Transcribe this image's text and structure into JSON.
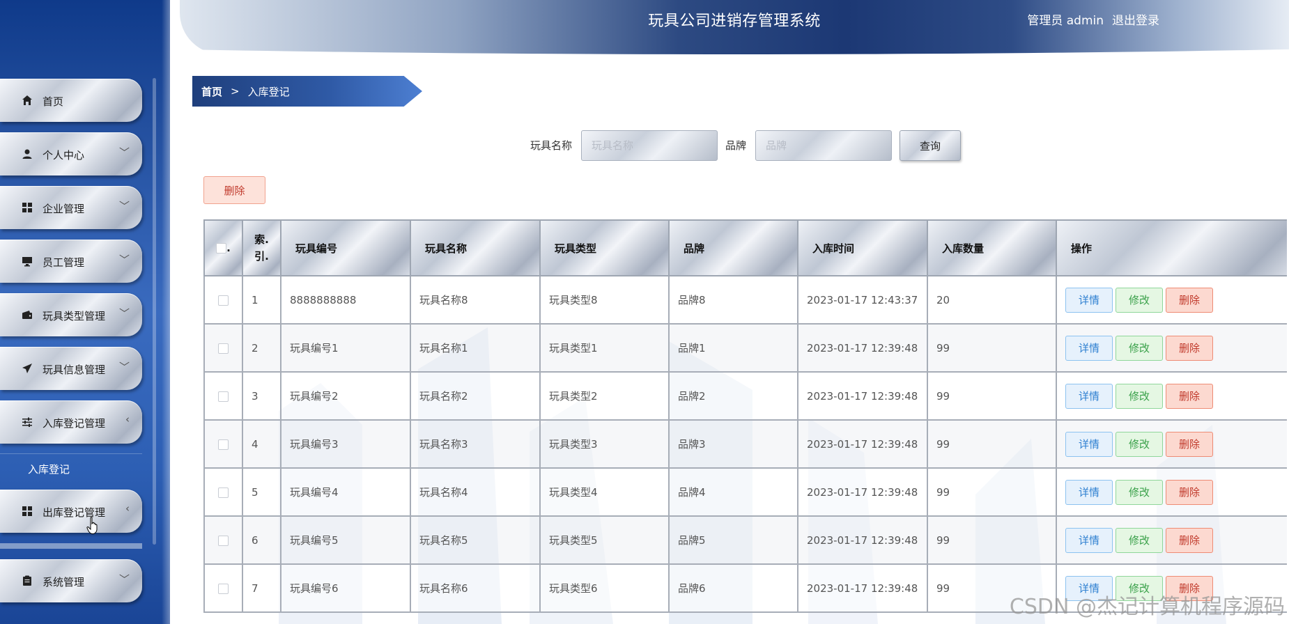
{
  "header": {
    "title": "玩具公司进销存管理系统",
    "user_label": "管理员 admin",
    "logout_label": "退出登录"
  },
  "sidebar": {
    "items": [
      {
        "label": "首页",
        "icon": "home-icon",
        "chevron": ""
      },
      {
        "label": "个人中心",
        "icon": "user-icon",
        "chevron": "﹀"
      },
      {
        "label": "企业管理",
        "icon": "grid-icon",
        "chevron": "﹀"
      },
      {
        "label": "员工管理",
        "icon": "monitor-icon",
        "chevron": "﹀"
      },
      {
        "label": "玩具类型管理",
        "icon": "wallet-icon",
        "chevron": "﹀"
      },
      {
        "label": "玩具信息管理",
        "icon": "send-icon",
        "chevron": "﹀"
      },
      {
        "label": "入库登记管理",
        "icon": "sliders-icon",
        "chevron": "‹"
      },
      {
        "label": "出库登记管理",
        "icon": "grid-icon",
        "chevron": "‹"
      },
      {
        "label": "系统管理",
        "icon": "clipboard-icon",
        "chevron": "﹀"
      }
    ],
    "sub_item": "入库登记"
  },
  "breadcrumb": {
    "home": "首页",
    "separator": ">",
    "current": "入库登记"
  },
  "search": {
    "name_label": "玩具名称",
    "name_placeholder": "玩具名称",
    "brand_label": "品牌",
    "brand_placeholder": "品牌",
    "query_label": "查询"
  },
  "toolbar": {
    "delete_label": "删除"
  },
  "table": {
    "columns": {
      "checkbox": ".",
      "index": "索引",
      "index_line1": "索.",
      "index_line2": "引.",
      "code": "玩具编号",
      "name": "玩具名称",
      "type": "玩具类型",
      "brand": "品牌",
      "time": "入库时间",
      "qty": "入库数量",
      "ops": "操作"
    },
    "rows": [
      {
        "idx": "1",
        "code": "8888888888",
        "name": "玩具名称8",
        "type": "玩具类型8",
        "brand": "品牌8",
        "time": "2023-01-17 12:43:37",
        "qty": "20"
      },
      {
        "idx": "2",
        "code": "玩具编号1",
        "name": "玩具名称1",
        "type": "玩具类型1",
        "brand": "品牌1",
        "time": "2023-01-17 12:39:48",
        "qty": "99"
      },
      {
        "idx": "3",
        "code": "玩具编号2",
        "name": "玩具名称2",
        "type": "玩具类型2",
        "brand": "品牌2",
        "time": "2023-01-17 12:39:48",
        "qty": "99"
      },
      {
        "idx": "4",
        "code": "玩具编号3",
        "name": "玩具名称3",
        "type": "玩具类型3",
        "brand": "品牌3",
        "time": "2023-01-17 12:39:48",
        "qty": "99"
      },
      {
        "idx": "5",
        "code": "玩具编号4",
        "name": "玩具名称4",
        "type": "玩具类型4",
        "brand": "品牌4",
        "time": "2023-01-17 12:39:48",
        "qty": "99"
      },
      {
        "idx": "6",
        "code": "玩具编号5",
        "name": "玩具名称5",
        "type": "玩具类型5",
        "brand": "品牌5",
        "time": "2023-01-17 12:39:48",
        "qty": "99"
      },
      {
        "idx": "7",
        "code": "玩具编号6",
        "name": "玩具名称6",
        "type": "玩具类型6",
        "brand": "品牌6",
        "time": "2023-01-17 12:39:48",
        "qty": "99"
      }
    ],
    "actions": {
      "detail": "详情",
      "edit": "修改",
      "delete": "删除"
    }
  },
  "watermark": "CSDN @杰记计算机程序源码",
  "colors": {
    "sidebar_dark": "#0f3a8a",
    "header_dark": "#1c3874",
    "detail": "#2f80d1",
    "edit": "#3aa14a",
    "delete": "#c0392b"
  }
}
